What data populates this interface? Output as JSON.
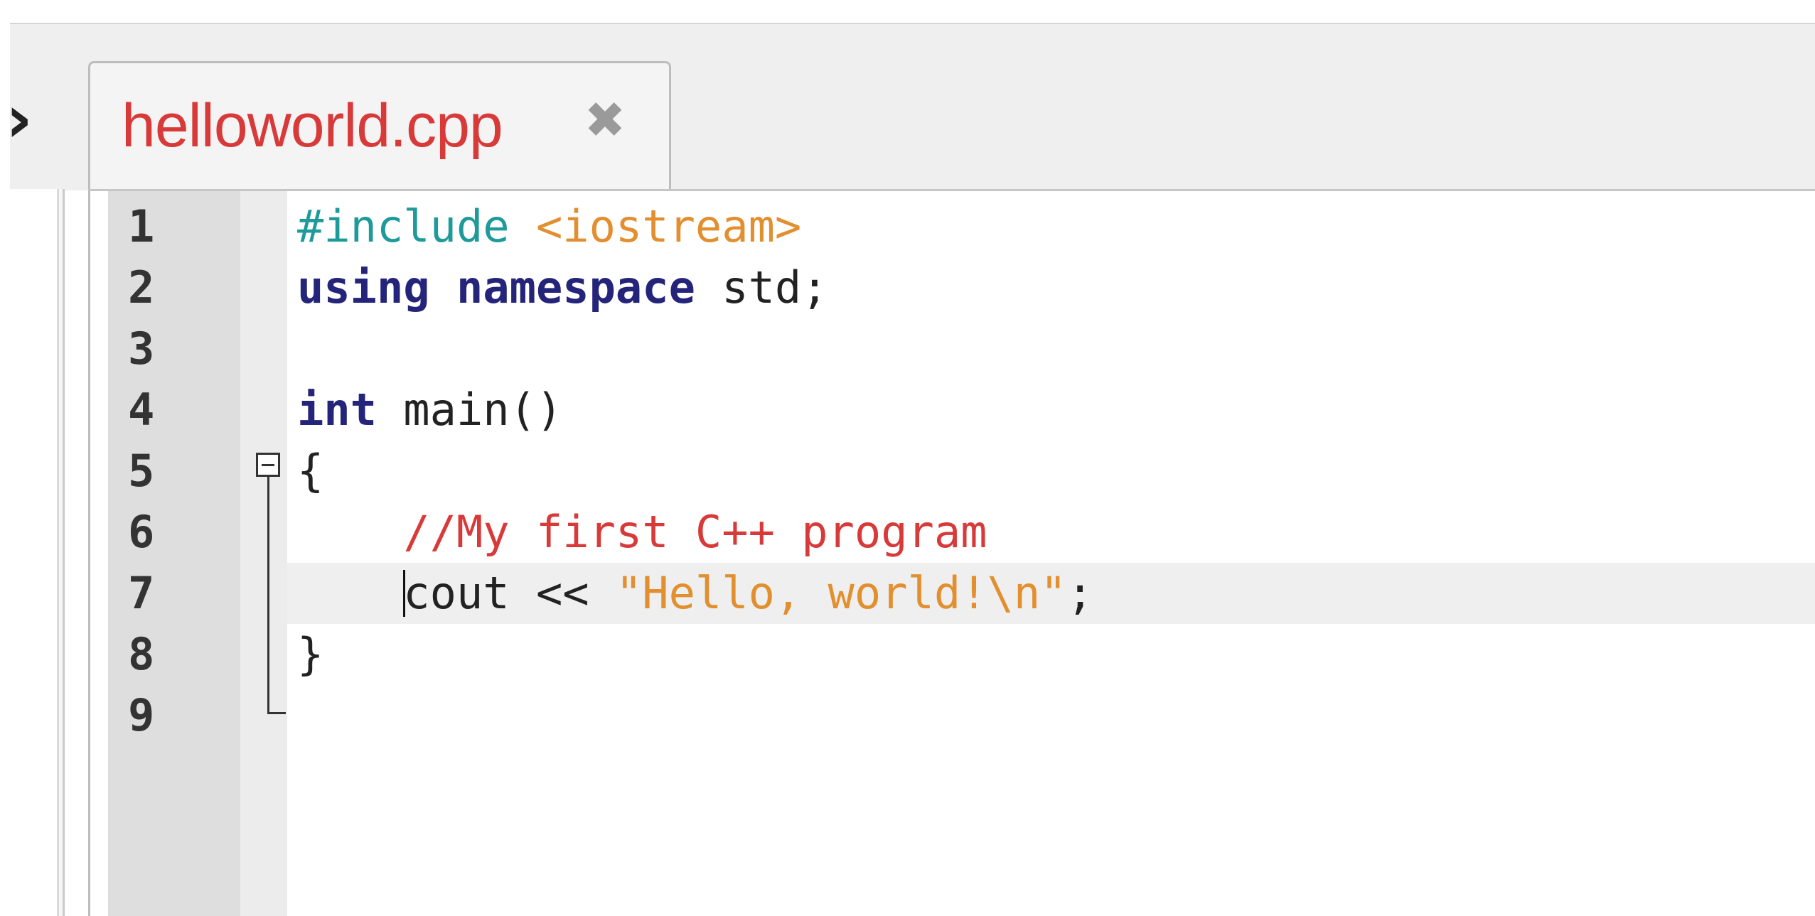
{
  "toolbar": {
    "expand_glyph": "›"
  },
  "tab": {
    "filename": "helloworld.cpp",
    "close_glyph": "✖"
  },
  "editor": {
    "line_numbers": [
      "1",
      "2",
      "3",
      "4",
      "5",
      "6",
      "7",
      "8",
      "9"
    ],
    "current_line": 7,
    "lines": [
      {
        "tokens": [
          {
            "cls": "pp",
            "text": "#include "
          },
          {
            "cls": "inc",
            "text": "<iostream>"
          }
        ]
      },
      {
        "tokens": [
          {
            "cls": "kw",
            "text": "using"
          },
          {
            "cls": "plain",
            "text": " "
          },
          {
            "cls": "kw",
            "text": "namespace"
          },
          {
            "cls": "plain",
            "text": " std;"
          }
        ]
      },
      {
        "tokens": []
      },
      {
        "tokens": [
          {
            "cls": "kw",
            "text": "int"
          },
          {
            "cls": "plain",
            "text": " main()"
          }
        ]
      },
      {
        "tokens": [
          {
            "cls": "plain",
            "text": "{"
          }
        ]
      },
      {
        "tokens": [
          {
            "cls": "plain",
            "text": "    "
          },
          {
            "cls": "cmt",
            "text": "//My first C++ program"
          }
        ]
      },
      {
        "tokens": [
          {
            "cls": "plain",
            "text": "    cout << "
          },
          {
            "cls": "str",
            "text": "\"Hello, world!\\n\""
          },
          {
            "cls": "plain",
            "text": ";"
          }
        ]
      },
      {
        "tokens": [
          {
            "cls": "plain",
            "text": "}"
          }
        ]
      },
      {
        "tokens": []
      }
    ]
  },
  "colors": {
    "tab_label": "#d83a3a",
    "keyword": "#24247a",
    "preprocessor": "#1f9a9a",
    "string": "#e28f2f",
    "comment": "#d83a3a",
    "gutter": "#dedede"
  }
}
